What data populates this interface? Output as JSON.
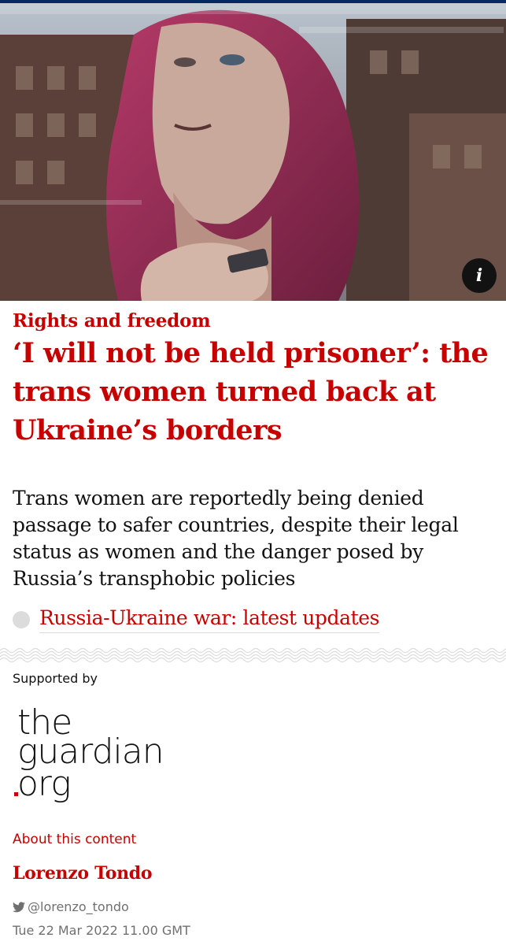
{
  "hero": {
    "info_icon": "info-icon",
    "info_glyph": "i"
  },
  "article": {
    "kicker": "Rights and freedom",
    "headline": "‘I will not be held prisoner’: the trans women turned back at Ukraine’s borders",
    "standfirst": "Trans women are reportedly being denied passage to safer countries, despite their legal status as women and the danger posed by Russia’s transphobic policies",
    "live_link": "Russia-Ukraine war: latest updates"
  },
  "sponsor": {
    "supported_by": "Supported by",
    "logo_line1": "the",
    "logo_line2": "guardian",
    "logo_line3": "org",
    "about_link": "About this content"
  },
  "author": {
    "name": "Lorenzo Tondo",
    "twitter_handle": "@lorenzo_tondo",
    "twitter_icon": "twitter-bird-icon"
  },
  "meta": {
    "published": "Tue 22 Mar 2022 11.00 GMT"
  },
  "colors": {
    "accent": "#c70000",
    "topbar": "#052962",
    "muted": "#707070"
  }
}
